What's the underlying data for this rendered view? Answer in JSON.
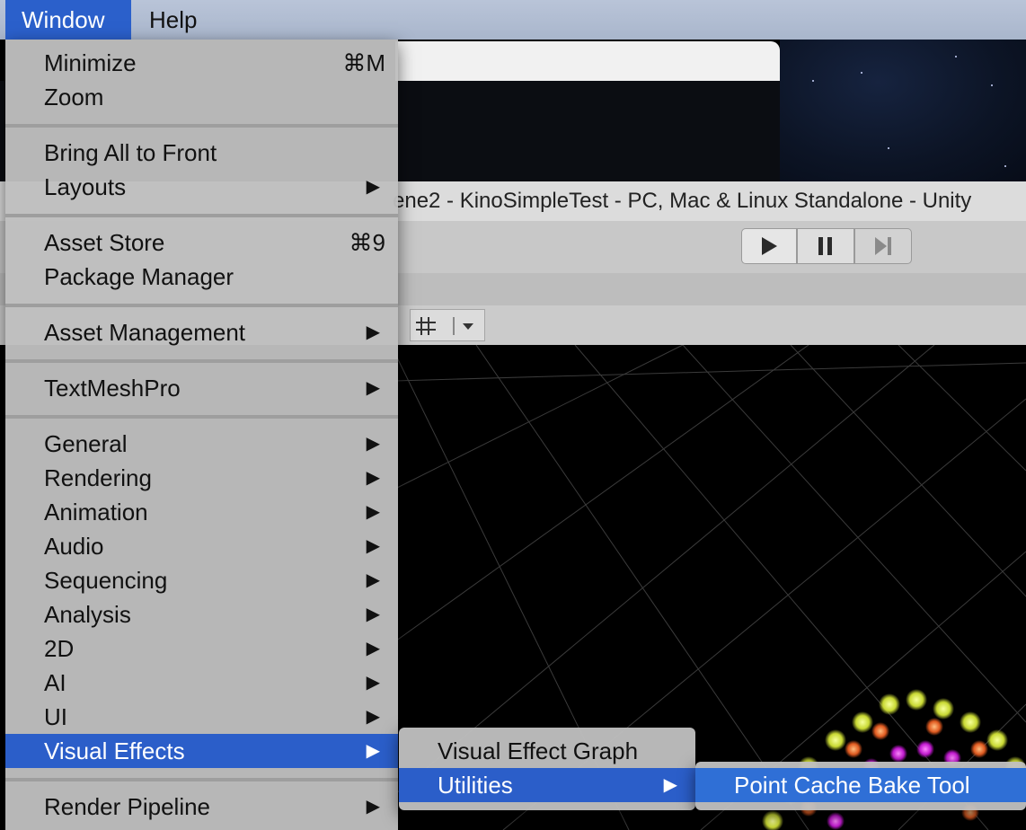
{
  "menubar": {
    "window": "Window",
    "help": "Help"
  },
  "unity": {
    "title": "ene2 - KinoSimpleTest - PC, Mac & Linux Standalone - Unity"
  },
  "window_menu": {
    "minimize": {
      "label": "Minimize",
      "shortcut": "⌘M"
    },
    "zoom": {
      "label": "Zoom"
    },
    "bring_all_to_front": {
      "label": "Bring All to Front"
    },
    "layouts": {
      "label": "Layouts"
    },
    "asset_store": {
      "label": "Asset Store",
      "shortcut": "⌘9"
    },
    "package_manager": {
      "label": "Package Manager"
    },
    "asset_management": {
      "label": "Asset Management"
    },
    "textmeshpro": {
      "label": "TextMeshPro"
    },
    "general": {
      "label": "General"
    },
    "rendering": {
      "label": "Rendering"
    },
    "animation": {
      "label": "Animation"
    },
    "audio": {
      "label": "Audio"
    },
    "sequencing": {
      "label": "Sequencing"
    },
    "analysis": {
      "label": "Analysis"
    },
    "2d": {
      "label": "2D"
    },
    "ai": {
      "label": "AI"
    },
    "ui": {
      "label": "UI"
    },
    "visual_effects": {
      "label": "Visual Effects"
    },
    "render_pipeline": {
      "label": "Render Pipeline"
    }
  },
  "visual_effects_submenu": {
    "graph": "Visual Effect Graph",
    "utilities": "Utilities"
  },
  "utilities_submenu": {
    "point_cache": "Point Cache Bake Tool"
  },
  "colors": {
    "highlight": "#2b5ec9",
    "menu_bg": "#bebebe",
    "menubar_bg": "#b2bed4"
  }
}
